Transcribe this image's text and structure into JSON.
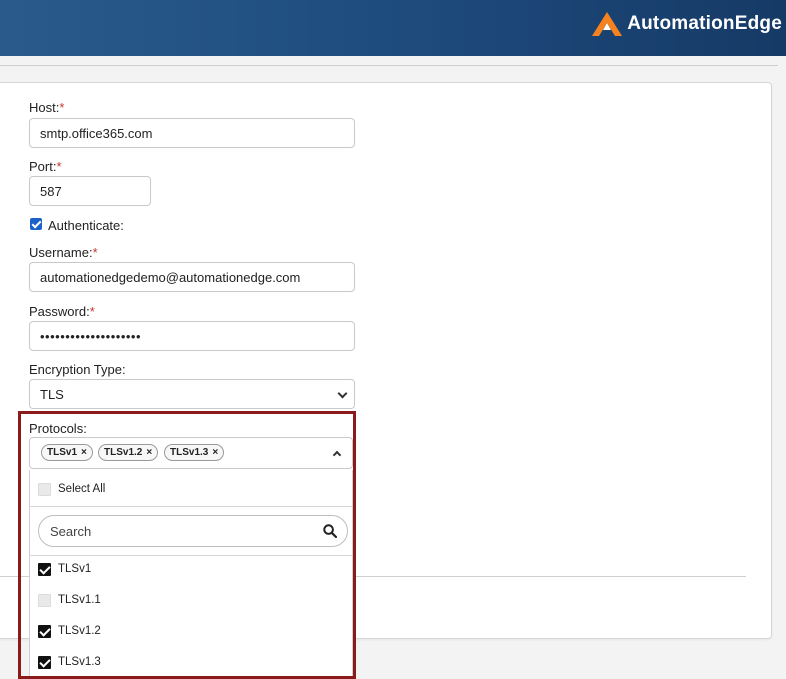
{
  "brand": {
    "name": "AutomationEdge",
    "accent": "#f5821f"
  },
  "form": {
    "host_label": "Host:",
    "host_value": "smtp.office365.com",
    "port_label": "Port:",
    "port_value": "587",
    "required_mark": "*",
    "authenticate_label": "Authenticate:",
    "authenticate_checked": true,
    "username_label": "Username:",
    "username_value": "automationedgedemo@automationedge.com",
    "password_label": "Password:",
    "password_value": "••••••••••••••••••••",
    "encryption_label": "Encryption Type:",
    "encryption_value": "TLS",
    "protocols_label": "Protocols:"
  },
  "protocols": {
    "selected_tags": [
      "TLSv1",
      "TLSv1.2",
      "TLSv1.3"
    ],
    "tag_remove": "×",
    "select_all_label": "Select All",
    "search_placeholder": "Search",
    "options": [
      {
        "label": "TLSv1",
        "checked": true
      },
      {
        "label": "TLSv1.1",
        "checked": false
      },
      {
        "label": "TLSv1.2",
        "checked": true
      },
      {
        "label": "TLSv1.3",
        "checked": true
      }
    ]
  },
  "colors": {
    "highlight_border": "#8b1a1a",
    "checkbox_blue": "#1a62c8",
    "required": "#c0392b"
  }
}
